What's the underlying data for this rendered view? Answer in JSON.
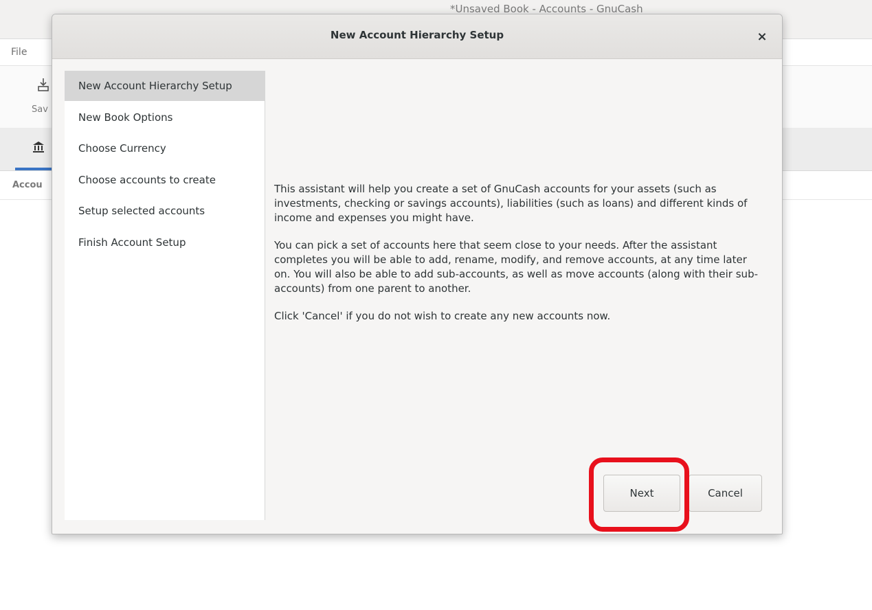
{
  "main_window": {
    "title": "*Unsaved Book - Accounts - GnuCash",
    "menu_file": "File",
    "toolbar_save_label": "Sav",
    "toolbar_save_icon": "save-icon",
    "accounts_tab_icon": "bank-icon",
    "accounts_label": "Accou"
  },
  "dialog": {
    "title": "New Account Hierarchy Setup",
    "close_glyph": "×",
    "steps": [
      {
        "label": "New Account Hierarchy Setup",
        "active": true
      },
      {
        "label": "New Book Options",
        "active": false
      },
      {
        "label": "Choose Currency",
        "active": false
      },
      {
        "label": "Choose accounts to create",
        "active": false
      },
      {
        "label": "Setup selected accounts",
        "active": false
      },
      {
        "label": "Finish Account Setup",
        "active": false
      }
    ],
    "paragraphs": [
      "This assistant will help you create a set of GnuCash accounts for your assets (such as investments, checking or savings accounts), liabilities (such as loans) and different kinds of income and expenses you might have.",
      "You can pick a set of accounts here that seem close to your needs. After the assistant completes you will be able to add, rename, modify, and remove accounts, at any time later on. You will also be able to add sub-accounts, as well as move accounts (along with their sub-accounts) from one parent to another.",
      "Click 'Cancel'  if you do not wish to create any new accounts now."
    ],
    "buttons": {
      "next": "Next",
      "cancel": "Cancel"
    }
  },
  "colors": {
    "highlight": "#e8101c",
    "tab_underline": "#3a74c4"
  }
}
